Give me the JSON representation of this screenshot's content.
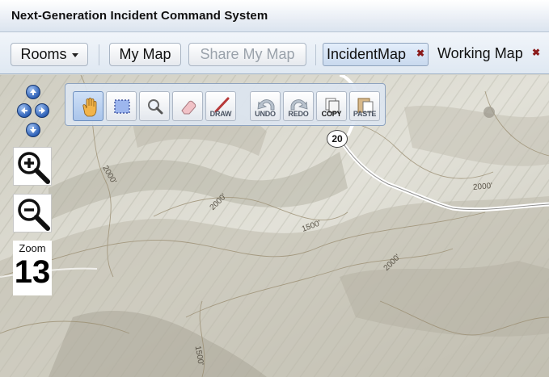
{
  "window": {
    "title": "Next-Generation Incident Command System"
  },
  "toolbar": {
    "rooms_label": "Rooms",
    "my_map_label": "My Map",
    "share_my_map_label": "Share My Map",
    "tabs": [
      {
        "label": "IncidentMap",
        "active": true
      },
      {
        "label": "Working Map",
        "active": false
      }
    ]
  },
  "navigation": {
    "zoom_label": "Zoom",
    "zoom_level": "13"
  },
  "palette": {
    "tools": [
      {
        "name": "pan",
        "icon": "hand-icon",
        "label": ""
      },
      {
        "name": "select",
        "icon": "select-box-icon",
        "label": ""
      },
      {
        "name": "zoom",
        "icon": "magnifier-icon",
        "label": ""
      },
      {
        "name": "erase",
        "icon": "eraser-icon",
        "label": ""
      },
      {
        "name": "draw",
        "icon": "pencil-icon",
        "label": "DRAW"
      },
      {
        "name": "undo",
        "icon": "undo-icon",
        "label": "UNDO"
      },
      {
        "name": "redo",
        "icon": "redo-icon",
        "label": "REDO"
      },
      {
        "name": "copy",
        "icon": "copy-icon",
        "label": "COPY"
      },
      {
        "name": "paste",
        "icon": "paste-icon",
        "label": "PASTE"
      }
    ]
  },
  "map": {
    "route_number": "20",
    "elevation_labels": [
      "2000'",
      "2000'",
      "1500'",
      "2000'",
      "2000'",
      "1500'"
    ]
  },
  "colors": {
    "accent": "#2f62b8",
    "close_mark": "#8b1a1a"
  }
}
